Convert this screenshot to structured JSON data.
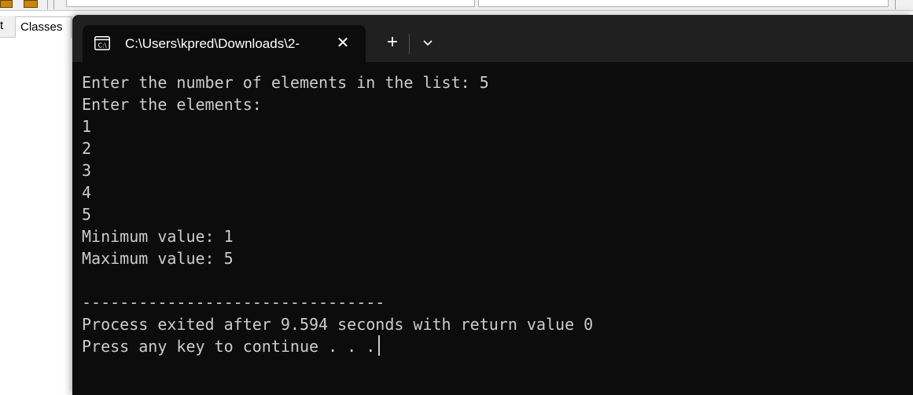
{
  "ide": {
    "tabs": [
      {
        "label": "t"
      },
      {
        "label": "Classes"
      }
    ]
  },
  "terminal": {
    "tab_title": "C:\\Users\\kpred\\Downloads\\2-",
    "icons": {
      "tab_icon": "terminal-icon",
      "close": "close-icon",
      "new_tab": "plus-icon",
      "dropdown": "chevron-down-icon"
    },
    "colors": {
      "background": "#0c0c0c",
      "titlebar": "#202020",
      "text": "#cccccc"
    },
    "output_lines": [
      "Enter the number of elements in the list: 5",
      "Enter the elements:",
      "1",
      "2",
      "3",
      "4",
      "5",
      "Minimum value: 1",
      "Maximum value: 5",
      "",
      "--------------------------------",
      "Process exited after 9.594 seconds with return value 0",
      "Press any key to continue . . ."
    ]
  }
}
